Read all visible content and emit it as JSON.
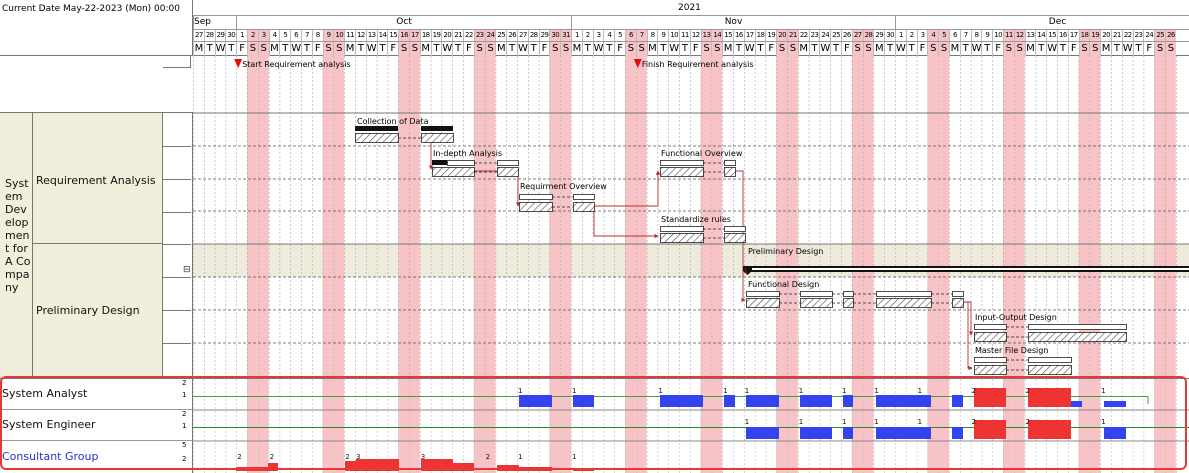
{
  "header": {
    "current_date": "Current Date May-22-2023 (Mon) 00:00",
    "year": "2021",
    "months": [
      {
        "label": "Sep",
        "day_start": 0,
        "day_count": 4
      },
      {
        "label": "Oct",
        "day_start": 4,
        "day_count": 31
      },
      {
        "label": "Nov",
        "day_start": 35,
        "day_count": 30
      },
      {
        "label": "Dec",
        "day_start": 65,
        "day_count": 30
      }
    ],
    "days": [
      "27",
      "28",
      "29",
      "30",
      "1",
      "2",
      "3",
      "4",
      "5",
      "6",
      "7",
      "8",
      "9",
      "10",
      "11",
      "12",
      "13",
      "14",
      "15",
      "16",
      "17",
      "18",
      "19",
      "20",
      "21",
      "22",
      "23",
      "24",
      "25",
      "26",
      "27",
      "28",
      "29",
      "30",
      "31",
      "1",
      "2",
      "3",
      "4",
      "5",
      "6",
      "7",
      "8",
      "9",
      "10",
      "11",
      "12",
      "13",
      "14",
      "15",
      "16",
      "17",
      "18",
      "19",
      "20",
      "21",
      "22",
      "23",
      "24",
      "25",
      "26",
      "27",
      "28",
      "29",
      "30",
      "1",
      "2",
      "3",
      "4",
      "5",
      "6",
      "7",
      "8",
      "9",
      "10",
      "11",
      "12",
      "13",
      "14",
      "15",
      "16",
      "17",
      "18",
      "19",
      "20",
      "21",
      "22",
      "23",
      "24",
      "25",
      "26"
    ],
    "weekday_letters": [
      "M",
      "T",
      "W",
      "T",
      "F",
      "S",
      "S"
    ],
    "weekend_day_indices": [
      5,
      6,
      12,
      13,
      19,
      20,
      26,
      27,
      33,
      34,
      40,
      41,
      47,
      48,
      54,
      55,
      61,
      62,
      68,
      69,
      75,
      76,
      82,
      83,
      89,
      90
    ]
  },
  "milestones": [
    {
      "label": "Start Requirement analysis",
      "day": 4
    },
    {
      "label": "Finish Requirement analysis",
      "day": 41
    }
  ],
  "tree": {
    "root": "System Development for A Company",
    "groups": [
      {
        "label": "Requirement Analysis"
      },
      {
        "label": "Preliminary Design",
        "collapse_icon": "⊟"
      }
    ]
  },
  "tasks": [
    {
      "label": "Collection of Data"
    },
    {
      "label": "In-depth Analysis"
    },
    {
      "label": "Requirment Overview"
    },
    {
      "label": "Functional Overview"
    },
    {
      "label": "Standardize rules"
    },
    {
      "label": "Preliminary Design"
    },
    {
      "label": "Functional Design"
    },
    {
      "label": "Input-Output Design"
    },
    {
      "label": "Master File Design"
    }
  ],
  "resources": [
    {
      "name": "System Analyst",
      "color": "#111111",
      "axis": [
        "2",
        "1"
      ]
    },
    {
      "name": "System Engineer",
      "color": "#111111",
      "axis": [
        "2",
        "1"
      ]
    },
    {
      "name": "Consultant Group",
      "color": "#2233cc",
      "axis": [
        "5",
        "2"
      ]
    }
  ],
  "resource_values": {
    "system_analyst": [
      {
        "day": 30,
        "value": "1"
      },
      {
        "day": 35,
        "value": "1"
      },
      {
        "day": 43,
        "value": "1"
      },
      {
        "day": 49,
        "value": "1"
      },
      {
        "day": 51,
        "value": "1"
      },
      {
        "day": 56,
        "value": "1"
      },
      {
        "day": 60,
        "value": "1"
      },
      {
        "day": 63,
        "value": "1"
      },
      {
        "day": 67,
        "value": "1"
      },
      {
        "day": 72,
        "value": "2"
      },
      {
        "day": 77,
        "value": "2"
      },
      {
        "day": 84,
        "value": "1"
      }
    ],
    "system_engineer": [
      {
        "day": 51,
        "value": "1"
      },
      {
        "day": 56,
        "value": "1"
      },
      {
        "day": 60,
        "value": "1"
      },
      {
        "day": 63,
        "value": "1"
      },
      {
        "day": 67,
        "value": "1"
      },
      {
        "day": 72,
        "value": "2"
      },
      {
        "day": 77,
        "value": "2"
      },
      {
        "day": 84,
        "value": "1"
      }
    ],
    "consultant_group": [
      {
        "day": 4,
        "value": "2"
      },
      {
        "day": 7,
        "value": "2"
      },
      {
        "day": 14,
        "value": "2"
      },
      {
        "day": 15,
        "value": "3"
      },
      {
        "day": 21,
        "value": "3"
      },
      {
        "day": 27,
        "value": "2"
      },
      {
        "day": 30,
        "value": "1"
      },
      {
        "day": 35,
        "value": "1"
      }
    ]
  },
  "colors": {
    "weekend": "#f7c3c6",
    "tree_bg": "#f1eedb",
    "highlight_row": "#eeebdc",
    "resource_bar": "#3344ee",
    "overload_bar": "#ee3333",
    "selection_border": "#e53935",
    "link": "#b53030"
  }
}
